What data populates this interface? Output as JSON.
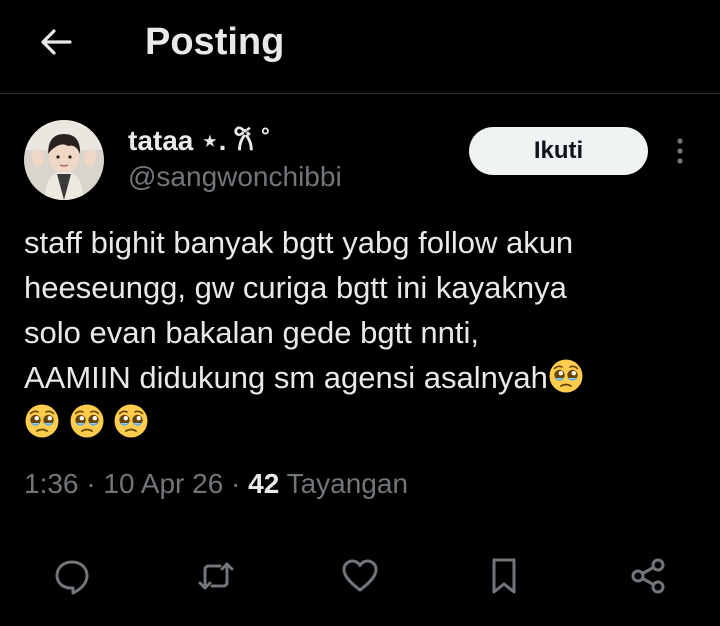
{
  "header": {
    "title": "Posting",
    "back_icon": "arrow-left-icon"
  },
  "author": {
    "display_name": "tataa ⋆. 𐙚 ˚",
    "handle": "@sangwonchibbi",
    "avatar": "profile-photo"
  },
  "follow_button": {
    "label": "Ikuti"
  },
  "post": {
    "lines": [
      "staff bighit banyak bgtt yabg follow akun",
      "heeseungg, gw curiga bgtt ini kayaknya",
      "solo evan bakalan gede bgtt nnti,",
      "AAMIIN didukung sm agensi asalnyah"
    ],
    "emoji": "pleading-face",
    "trailing_emoji_count": 3
  },
  "meta": {
    "time": "1:36",
    "separator": " · ",
    "date": "10 Apr 26",
    "views_count": "42",
    "views_label": "Tayangan"
  },
  "actions": [
    {
      "name": "reply",
      "icon": "reply-icon"
    },
    {
      "name": "repost",
      "icon": "repost-icon"
    },
    {
      "name": "like",
      "icon": "heart-icon"
    },
    {
      "name": "bookmark",
      "icon": "bookmark-icon"
    },
    {
      "name": "share",
      "icon": "share-icon"
    }
  ],
  "colors": {
    "background": "#000000",
    "text": "#e7e9ea",
    "secondary_text": "#71767b",
    "divider": "#2f3336",
    "follow_bg": "#eff3f4",
    "follow_text": "#0f1419"
  }
}
